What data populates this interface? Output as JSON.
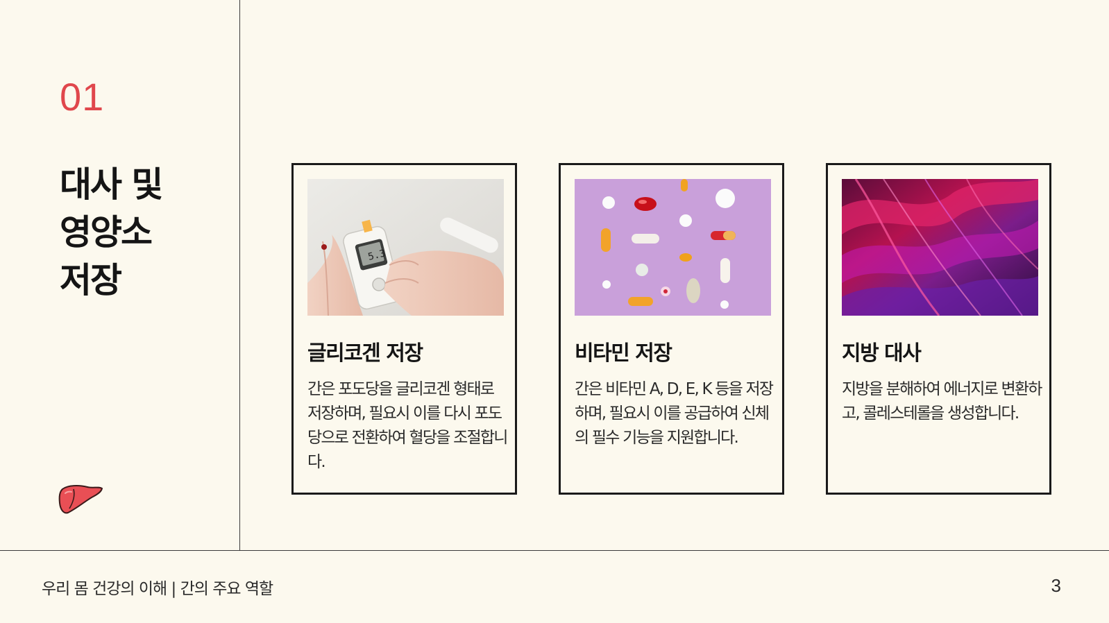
{
  "section": {
    "number": "01",
    "title_lines": [
      "대사 및",
      "영양소",
      "저장"
    ],
    "accent_color": "#e0474c",
    "icon": "liver-icon"
  },
  "cards": [
    {
      "image": "glucose-meter-photo",
      "title": "글리코겐 저장",
      "desc": "간은 포도당을 글리코겐 형태로 저장하며, 필요시 이를 다시 포도당으로 전환하여 혈당을 조절합니다."
    },
    {
      "image": "vitamin-pills-photo",
      "title": "비타민 저장",
      "desc": "간은 비타민 A, D, E, K 등을 저장하며, 필요시 이를 공급하여 신체의 필수 기능을 지원합니다."
    },
    {
      "image": "abstract-fat-texture-photo",
      "title": "지방 대사",
      "desc": "지방을 분해하여 에너지로 변환하고, 콜레스테롤을 생성합니다."
    }
  ],
  "footer": {
    "text": "우리 몸 건강의 이해 | 간의 주요 역할",
    "page_number": "3"
  },
  "colors": {
    "background": "#fcf9ee",
    "text": "#1a1a1a",
    "accent": "#e0474c"
  }
}
